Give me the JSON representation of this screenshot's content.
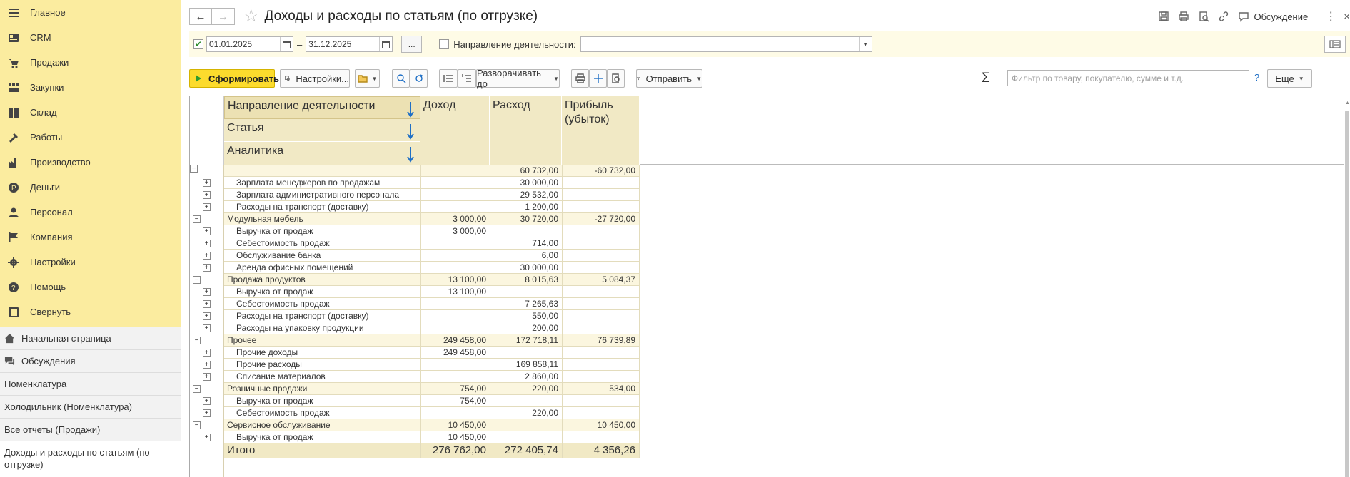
{
  "sidebar": {
    "items": [
      {
        "label": "Главное",
        "icon": "menu-icon"
      },
      {
        "label": "CRM",
        "icon": "crm-icon"
      },
      {
        "label": "Продажи",
        "icon": "cart-icon"
      },
      {
        "label": "Закупки",
        "icon": "purchases-icon"
      },
      {
        "label": "Склад",
        "icon": "warehouse-icon"
      },
      {
        "label": "Работы",
        "icon": "tools-icon"
      },
      {
        "label": "Производство",
        "icon": "factory-icon"
      },
      {
        "label": "Деньги",
        "icon": "ruble-icon"
      },
      {
        "label": "Персонал",
        "icon": "person-icon"
      },
      {
        "label": "Компания",
        "icon": "flag-icon"
      },
      {
        "label": "Настройки",
        "icon": "gear-icon"
      },
      {
        "label": "Помощь",
        "icon": "help-icon"
      },
      {
        "label": "Свернуть",
        "icon": "collapse-icon"
      }
    ],
    "open": [
      {
        "label": "Начальная страница",
        "icon": "home-icon"
      },
      {
        "label": "Обсуждения",
        "icon": "chat-icon"
      },
      {
        "label": "Номенклатура"
      },
      {
        "label": "Холодильник (Номенклатура)"
      },
      {
        "label": "Все отчеты (Продажи)"
      },
      {
        "label": "Доходы и расходы по статьям (по отгрузке)"
      }
    ]
  },
  "header": {
    "title": "Доходы и расходы по статьям (по отгрузке)",
    "discuss_label": "Обсуждение",
    "more": "⋮",
    "close": "×"
  },
  "params": {
    "date_from": "01.01.2025",
    "date_to": "31.12.2025",
    "dash": "–",
    "more_period": "...",
    "direction_label": "Направление деятельности:",
    "direction_value": ""
  },
  "toolbar": {
    "generate": "Сформировать",
    "settings": "Настройки...",
    "expand_to": "Разворачивать до",
    "send": "Отправить",
    "filter_placeholder": "Фильтр по товару, покупателю, сумме и т.д.",
    "help": "?",
    "more": "Еще",
    "sigma": "Σ"
  },
  "report": {
    "headers": {
      "group1": "Направление деятельности",
      "group2": "Статья",
      "group3": "Аналитика",
      "income": "Доход",
      "expense": "Расход",
      "profit": "Прибыль (убыток)"
    },
    "rows": [
      {
        "kind": "top",
        "name": "",
        "income": "",
        "expense": "60 732,00",
        "profit": "-60 732,00"
      },
      {
        "kind": "c",
        "name": "Зарплата менеджеров по продажам",
        "income": "",
        "expense": "30 000,00",
        "profit": ""
      },
      {
        "kind": "c",
        "name": "Зарплата административного персонала",
        "income": "",
        "expense": "29 532,00",
        "profit": ""
      },
      {
        "kind": "c",
        "name": "Расходы на транспорт (доставку)",
        "income": "",
        "expense": "1 200,00",
        "profit": ""
      },
      {
        "kind": "g",
        "name": "Модульная мебель",
        "income": "3 000,00",
        "expense": "30 720,00",
        "profit": "-27 720,00"
      },
      {
        "kind": "c",
        "name": "Выручка от продаж",
        "income": "3 000,00",
        "expense": "",
        "profit": ""
      },
      {
        "kind": "c",
        "name": "Себестоимость продаж",
        "income": "",
        "expense": "714,00",
        "profit": ""
      },
      {
        "kind": "c",
        "name": "Обслуживание банка",
        "income": "",
        "expense": "6,00",
        "profit": ""
      },
      {
        "kind": "c",
        "name": "Аренда офисных помещений",
        "income": "",
        "expense": "30 000,00",
        "profit": ""
      },
      {
        "kind": "g",
        "name": "Продажа продуктов",
        "income": "13 100,00",
        "expense": "8 015,63",
        "profit": "5 084,37"
      },
      {
        "kind": "c",
        "name": "Выручка от продаж",
        "income": "13 100,00",
        "expense": "",
        "profit": ""
      },
      {
        "kind": "c",
        "name": "Себестоимость продаж",
        "income": "",
        "expense": "7 265,63",
        "profit": ""
      },
      {
        "kind": "c",
        "name": "Расходы на транспорт (доставку)",
        "income": "",
        "expense": "550,00",
        "profit": ""
      },
      {
        "kind": "c",
        "name": "Расходы на упаковку продукции",
        "income": "",
        "expense": "200,00",
        "profit": ""
      },
      {
        "kind": "g",
        "name": "Прочее",
        "income": "249 458,00",
        "expense": "172 718,11",
        "profit": "76 739,89"
      },
      {
        "kind": "c",
        "name": "Прочие доходы",
        "income": "249 458,00",
        "expense": "",
        "profit": ""
      },
      {
        "kind": "c",
        "name": "Прочие расходы",
        "income": "",
        "expense": "169 858,11",
        "profit": ""
      },
      {
        "kind": "c",
        "name": "Списание материалов",
        "income": "",
        "expense": "2 860,00",
        "profit": ""
      },
      {
        "kind": "g",
        "name": "Розничные продажи",
        "income": "754,00",
        "expense": "220,00",
        "profit": "534,00"
      },
      {
        "kind": "c",
        "name": "Выручка от продаж",
        "income": "754,00",
        "expense": "",
        "profit": ""
      },
      {
        "kind": "c",
        "name": "Себестоимость продаж",
        "income": "",
        "expense": "220,00",
        "profit": ""
      },
      {
        "kind": "g",
        "name": "Сервисное обслуживание",
        "income": "10 450,00",
        "expense": "",
        "profit": "10 450,00"
      },
      {
        "kind": "c",
        "name": "Выручка от продаж",
        "income": "10 450,00",
        "expense": "",
        "profit": ""
      }
    ],
    "total": {
      "name": "Итого",
      "income": "276 762,00",
      "expense": "272 405,74",
      "profit": "4 356,26"
    }
  },
  "colors": {
    "sidebar_bg": "#fbec9f",
    "accent_button": "#fcdb2d",
    "header_bg": "#f1e9c5",
    "sort_arrow": "#1f6fc5"
  }
}
